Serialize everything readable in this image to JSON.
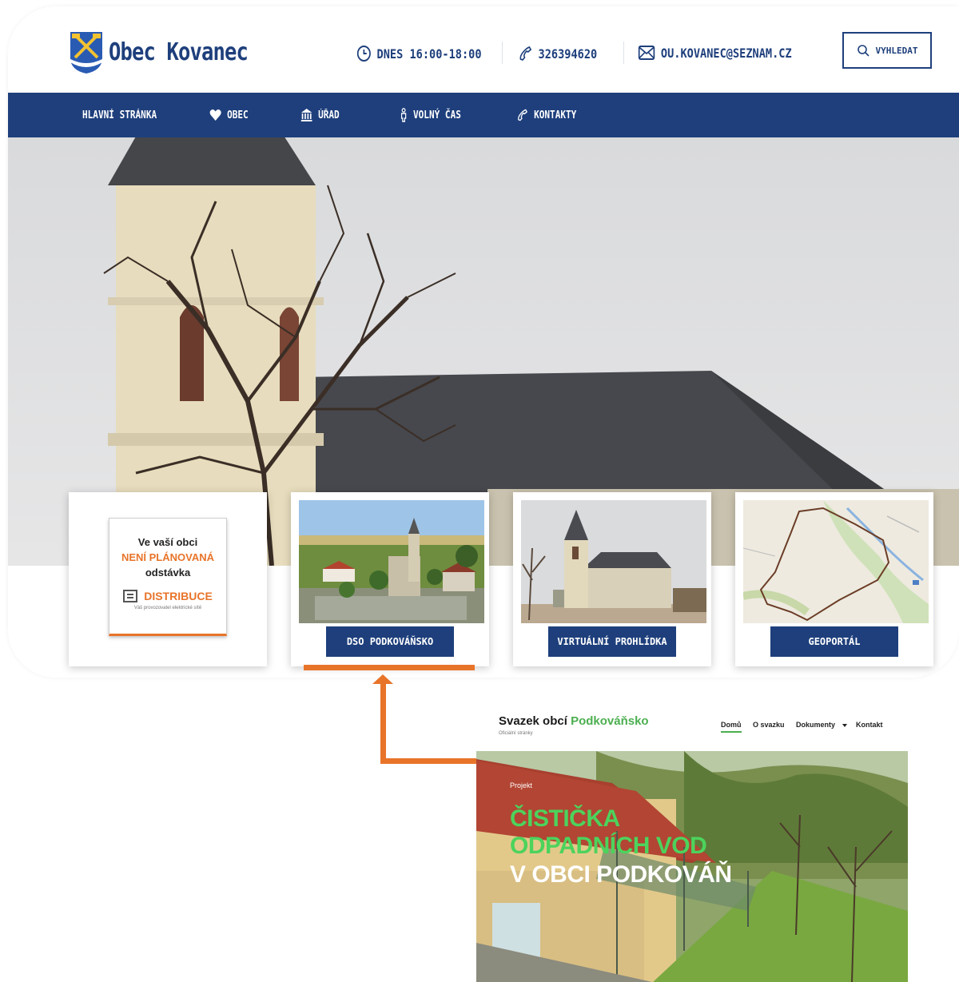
{
  "site": {
    "title": "Obec Kovanec",
    "hours": "DNES 16:00-18:00",
    "phone": "326394620",
    "email": "OU.KOVANEC@SEZNAM.CZ",
    "search_label": "VYHLEDAT"
  },
  "nav": {
    "items": [
      {
        "label": "HLAVNÍ STRÁNKA",
        "icon": ""
      },
      {
        "label": "OBEC",
        "icon": "heart-icon"
      },
      {
        "label": "ÚŘAD",
        "icon": "building-icon"
      },
      {
        "label": "VOLNÝ ČAS",
        "icon": "person-icon"
      },
      {
        "label": "KONTAKTY",
        "icon": "phone-icon"
      }
    ]
  },
  "notice": {
    "line1": "Ve vaší obci",
    "line2": "NENÍ PLÁNOVANÁ",
    "line3": "odstávka",
    "brand": "DISTRIBUCE",
    "tagline": "Váš provozovatel elektrické sítě"
  },
  "tiles": [
    {
      "label": "DSO PODKOVÁŇSKO"
    },
    {
      "label": "VIRTUÁLNÍ PROHLÍDKA"
    },
    {
      "label": "GEOPORTÁL"
    }
  ],
  "podkovansko": {
    "title_main": "Svazek obcí",
    "title_accent": "Podkováňsko",
    "subtitle": "Oficiální stránky",
    "nav": [
      "Domů",
      "O svazku",
      "Dokumenty",
      "Kontakt"
    ],
    "hero_label": "Projekt",
    "hero_line1": "ČISTIČKA",
    "hero_line2": "ODPADNÍCH VOD",
    "hero_line3": "V OBCI PODKOVÁŇ"
  },
  "colors": {
    "brand_blue": "#1e3f7c",
    "accent_orange": "#e8742a",
    "accent_green": "#4cd35c"
  }
}
